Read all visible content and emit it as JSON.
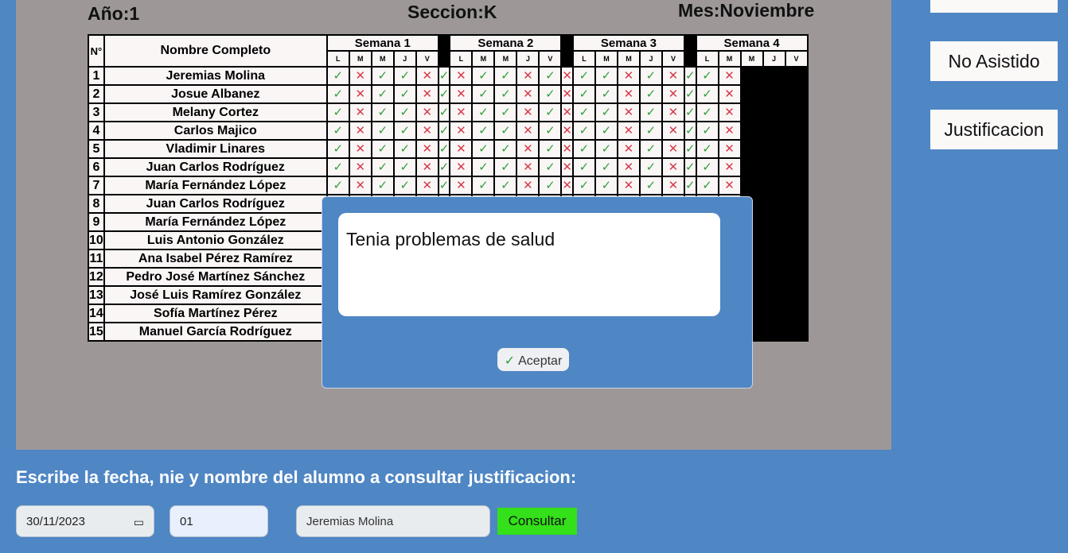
{
  "header": {
    "year": "Año:1",
    "section": "Seccion:K",
    "month": "Mes:Noviembre"
  },
  "table": {
    "num_header": "N°",
    "name_header": "Nombre Completo",
    "weeks": [
      "Semana 1",
      "Semana 2",
      "Semana 3",
      "Semana 4"
    ],
    "days": [
      "L",
      "M",
      "M",
      "J",
      "V"
    ],
    "pattern": [
      "ok",
      "no",
      "ok",
      "ok",
      "no"
    ],
    "rows": [
      {
        "num": "1",
        "name": "Jeremias Molina"
      },
      {
        "num": "2",
        "name": "Josue Albanez"
      },
      {
        "num": "3",
        "name": "Melany Cortez"
      },
      {
        "num": "4",
        "name": "Carlos Majico"
      },
      {
        "num": "5",
        "name": "Vladimir Linares"
      },
      {
        "num": "6",
        "name": "Juan Carlos Rodríguez"
      },
      {
        "num": "7",
        "name": "María Fernández López"
      },
      {
        "num": "8",
        "name": "Juan Carlos Rodríguez"
      },
      {
        "num": "9",
        "name": "María Fernández López"
      },
      {
        "num": "10",
        "name": "Luis Antonio González"
      },
      {
        "num": "11",
        "name": "Ana Isabel Pérez Ramírez"
      },
      {
        "num": "12",
        "name": "Pedro José Martínez Sánchez"
      },
      {
        "num": "13",
        "name": "José Luis Ramírez González"
      },
      {
        "num": "14",
        "name": "Sofía Martínez Pérez"
      },
      {
        "num": "15",
        "name": "Manuel García Rodríguez"
      }
    ]
  },
  "sidebar": {
    "not_attended": "No Asistido",
    "justification": "Justificacion"
  },
  "modal": {
    "text": "Tenia problemas de salud",
    "accept_label": "Aceptar"
  },
  "query": {
    "prompt": "Escribe la fecha, nie y nombre del alumno a consultar justificacion:",
    "date_value": "30/11/2023",
    "nie_value": "01",
    "name_value": "Jeremias Molina",
    "consult_label": "Consultar"
  },
  "colors": {
    "background": "#4f86c4",
    "panel": "#9d9897",
    "present": "#2ea03a",
    "absent": "#d63a4a",
    "consult_button": "#33e019"
  },
  "icons": {
    "present": "check-icon",
    "absent": "cross-icon",
    "calendar": "calendar-icon"
  }
}
